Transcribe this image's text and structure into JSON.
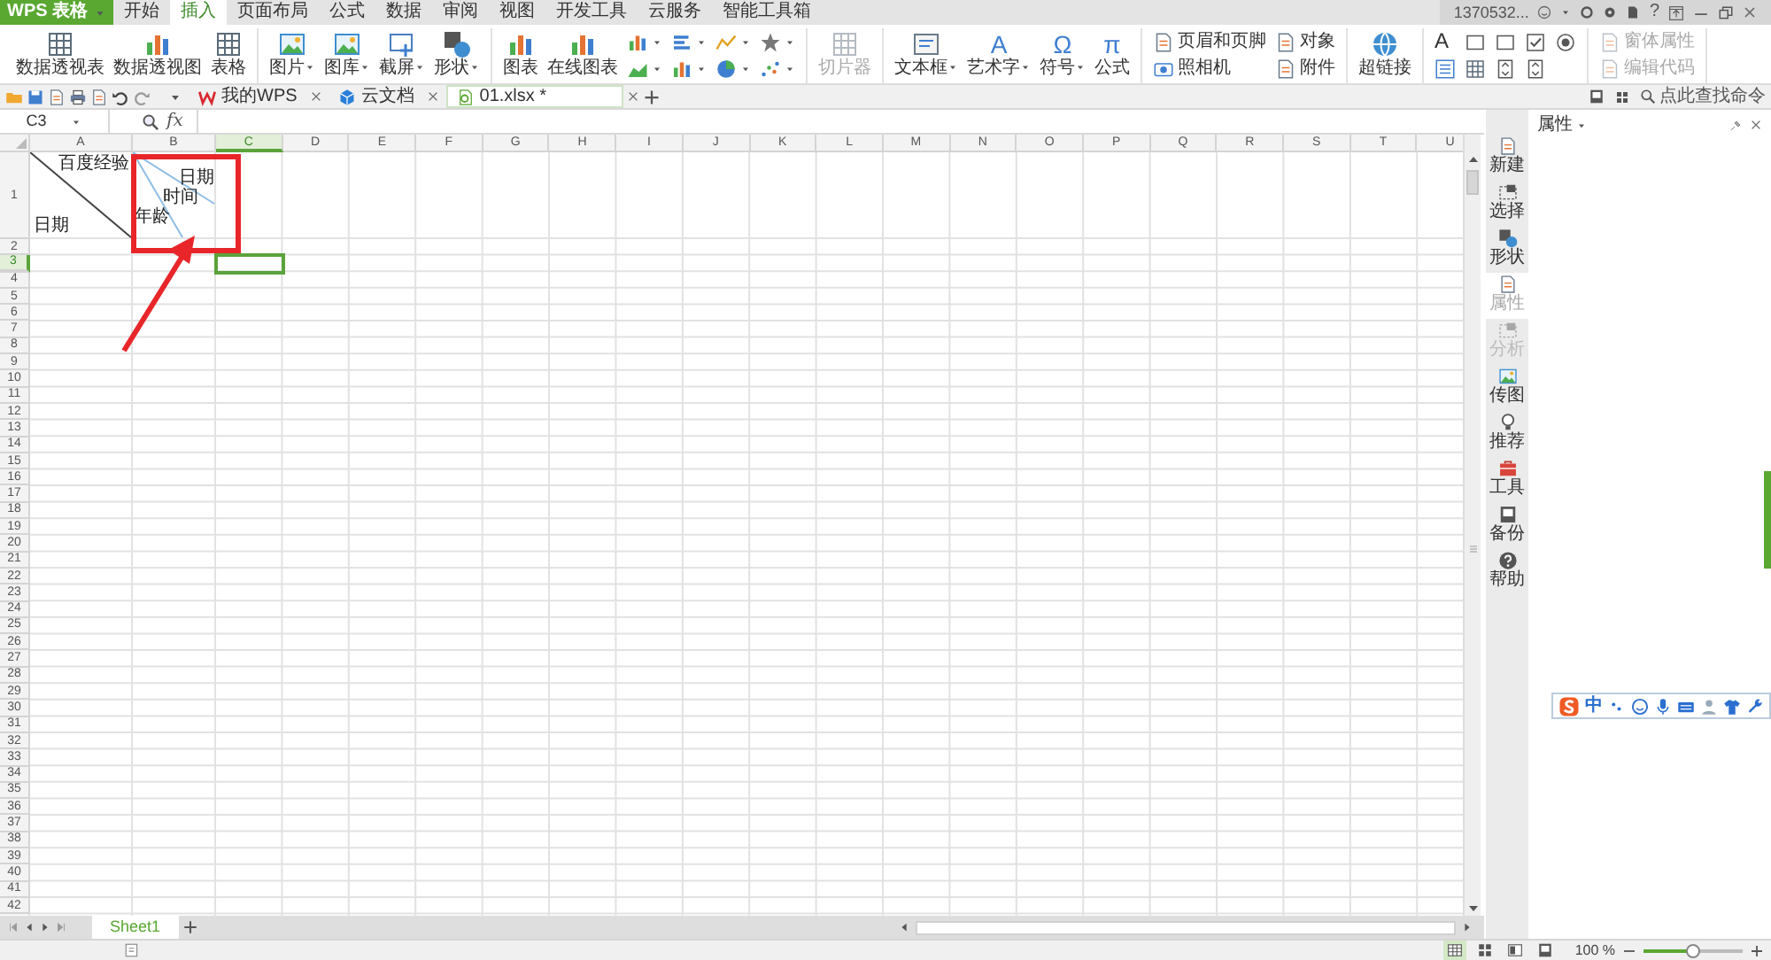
{
  "app_button": {
    "label": "WPS 表格"
  },
  "menu_tabs": [
    {
      "label": "开始",
      "selected": false
    },
    {
      "label": "插入",
      "selected": true
    },
    {
      "label": "页面布局",
      "selected": false
    },
    {
      "label": "公式",
      "selected": false
    },
    {
      "label": "数据",
      "selected": false
    },
    {
      "label": "审阅",
      "selected": false
    },
    {
      "label": "视图",
      "selected": false
    },
    {
      "label": "开发工具",
      "selected": false
    },
    {
      "label": "云服务",
      "selected": false
    },
    {
      "label": "智能工具箱",
      "selected": false
    }
  ],
  "account": {
    "user": "1370532...",
    "help": "?"
  },
  "ribbon_groups": [
    {
      "items": [
        {
          "kind": "large",
          "label": "数据透视表",
          "dropdown": false,
          "disabled": false
        },
        {
          "kind": "large",
          "label": "数据透视图",
          "dropdown": false,
          "disabled": false
        },
        {
          "kind": "large",
          "label": "表格",
          "dropdown": false,
          "disabled": false
        }
      ]
    },
    {
      "items": [
        {
          "kind": "large",
          "label": "图片",
          "dropdown": true,
          "disabled": false
        },
        {
          "kind": "large",
          "label": "图库",
          "dropdown": true,
          "disabled": false
        },
        {
          "kind": "large",
          "label": "截屏",
          "dropdown": true,
          "disabled": false
        },
        {
          "kind": "large",
          "label": "形状",
          "dropdown": true,
          "disabled": false
        }
      ]
    },
    {
      "items": [
        {
          "kind": "large",
          "label": "图表",
          "dropdown": false,
          "disabled": false
        },
        {
          "kind": "large",
          "label": "在线图表",
          "dropdown": false,
          "disabled": false
        },
        {
          "kind": "mini",
          "dropdown": true,
          "disabled": false
        },
        {
          "kind": "mini",
          "dropdown": true,
          "disabled": false
        },
        {
          "kind": "mini",
          "dropdown": true,
          "disabled": false
        },
        {
          "kind": "mini",
          "dropdown": true,
          "disabled": false
        },
        {
          "kind": "mini",
          "dropdown": true,
          "disabled": false
        },
        {
          "kind": "mini",
          "dropdown": true,
          "disabled": false
        },
        {
          "kind": "mini",
          "dropdown": true,
          "disabled": false
        },
        {
          "kind": "mini",
          "dropdown": true,
          "disabled": false
        }
      ]
    },
    {
      "items": [
        {
          "kind": "large",
          "label": "切片器",
          "dropdown": false,
          "disabled": true
        }
      ]
    },
    {
      "items": [
        {
          "kind": "large",
          "label": "文本框",
          "dropdown": true,
          "disabled": false
        },
        {
          "kind": "large",
          "label": "艺术字",
          "glyph": "A",
          "dropdown": true,
          "disabled": false
        },
        {
          "kind": "large",
          "label": "符号",
          "glyph": "Ω",
          "dropdown": true,
          "disabled": false
        },
        {
          "kind": "large",
          "label": "公式",
          "glyph": "π",
          "dropdown": false,
          "disabled": false
        }
      ]
    },
    {
      "items": [
        {
          "kind": "small",
          "label": "页眉和页脚",
          "dropdown": false,
          "disabled": false
        },
        {
          "kind": "small",
          "label": "照相机",
          "dropdown": false,
          "disabled": false
        },
        {
          "kind": "small",
          "label": "对象",
          "dropdown": false,
          "disabled": false
        },
        {
          "kind": "small",
          "label": "附件",
          "dropdown": false,
          "disabled": false
        }
      ]
    },
    {
      "items": [
        {
          "kind": "large",
          "label": "超链接",
          "dropdown": false,
          "disabled": false
        }
      ]
    },
    {
      "items": [
        {
          "kind": "mini",
          "glyph": "A",
          "dropdown": false,
          "disabled": false
        },
        {
          "kind": "mini",
          "dropdown": false,
          "disabled": false
        },
        {
          "kind": "mini",
          "dropdown": false,
          "disabled": false
        },
        {
          "kind": "mini",
          "dropdown": false,
          "disabled": false
        },
        {
          "kind": "mini",
          "dropdown": false,
          "disabled": false
        },
        {
          "kind": "mini",
          "dropdown": false,
          "disabled": false
        },
        {
          "kind": "mini",
          "dropdown": false,
          "disabled": false
        },
        {
          "kind": "mini",
          "dropdown": false,
          "disabled": false
        },
        {
          "kind": "mini",
          "dropdown": false,
          "disabled": false
        }
      ]
    },
    {
      "items": [
        {
          "kind": "small",
          "label": "窗体属性",
          "dropdown": false,
          "disabled": true
        },
        {
          "kind": "small",
          "label": "编辑代码",
          "dropdown": false,
          "disabled": true
        }
      ]
    }
  ],
  "doc_tabs": [
    {
      "label": "我的WPS",
      "selected": false
    },
    {
      "label": "云文档",
      "selected": false
    },
    {
      "label": "01.xlsx *",
      "selected": true
    }
  ],
  "command_search": {
    "label": "点此查找命令"
  },
  "formula_bar": {
    "name_box": "C3",
    "fx": "fx"
  },
  "sheet": {
    "columns": [
      {
        "label": "A",
        "selected": false
      },
      {
        "label": "B",
        "selected": false
      },
      {
        "label": "C",
        "selected": true
      },
      {
        "label": "D",
        "selected": false
      },
      {
        "label": "E",
        "selected": false
      },
      {
        "label": "F",
        "selected": false
      },
      {
        "label": "G",
        "selected": false
      },
      {
        "label": "H",
        "selected": false
      },
      {
        "label": "I",
        "selected": false
      },
      {
        "label": "J",
        "selected": false
      },
      {
        "label": "K",
        "selected": false
      },
      {
        "label": "L",
        "selected": false
      },
      {
        "label": "M",
        "selected": false
      },
      {
        "label": "N",
        "selected": false
      },
      {
        "label": "O",
        "selected": false
      },
      {
        "label": "P",
        "selected": false
      },
      {
        "label": "Q",
        "selected": false
      },
      {
        "label": "R",
        "selected": false
      },
      {
        "label": "S",
        "selected": false
      },
      {
        "label": "T",
        "selected": false
      },
      {
        "label": "U",
        "selected": false
      }
    ],
    "rows": [
      {
        "label": "1",
        "selected": false
      },
      {
        "label": "2",
        "selected": false
      },
      {
        "label": "3",
        "selected": true
      },
      {
        "label": "4",
        "selected": false
      },
      {
        "label": "5",
        "selected": false
      },
      {
        "label": "6",
        "selected": false
      },
      {
        "label": "7",
        "selected": false
      },
      {
        "label": "8",
        "selected": false
      },
      {
        "label": "9",
        "selected": false
      },
      {
        "label": "10",
        "selected": false
      },
      {
        "label": "11",
        "selected": false
      },
      {
        "label": "12",
        "selected": false
      },
      {
        "label": "13",
        "selected": false
      },
      {
        "label": "14",
        "selected": false
      },
      {
        "label": "15",
        "selected": false
      },
      {
        "label": "16",
        "selected": false
      },
      {
        "label": "17",
        "selected": false
      },
      {
        "label": "18",
        "selected": false
      },
      {
        "label": "19",
        "selected": false
      },
      {
        "label": "20",
        "selected": false
      },
      {
        "label": "21",
        "selected": false
      },
      {
        "label": "22",
        "selected": false
      },
      {
        "label": "23",
        "selected": false
      },
      {
        "label": "24",
        "selected": false
      },
      {
        "label": "25",
        "selected": false
      },
      {
        "label": "26",
        "selected": false
      },
      {
        "label": "27",
        "selected": false
      },
      {
        "label": "28",
        "selected": false
      },
      {
        "label": "29",
        "selected": false
      },
      {
        "label": "30",
        "selected": false
      },
      {
        "label": "31",
        "selected": false
      },
      {
        "label": "32",
        "selected": false
      },
      {
        "label": "33",
        "selected": false
      },
      {
        "label": "34",
        "selected": false
      },
      {
        "label": "35",
        "selected": false
      },
      {
        "label": "36",
        "selected": false
      },
      {
        "label": "37",
        "selected": false
      },
      {
        "label": "38",
        "selected": false
      },
      {
        "label": "39",
        "selected": false
      },
      {
        "label": "40",
        "selected": false
      },
      {
        "label": "41",
        "selected": false
      },
      {
        "label": "42",
        "selected": false
      }
    ],
    "diagonal_cells": [
      {
        "kind": "single",
        "texts": [
          "百度经验",
          "日期"
        ]
      },
      {
        "kind": "double",
        "texts": [
          "日期",
          "时间",
          "年龄"
        ]
      }
    ]
  },
  "sidebar": {
    "items": [
      {
        "label": "新建",
        "selected": false,
        "disabled": false
      },
      {
        "label": "选择",
        "selected": false,
        "disabled": false
      },
      {
        "label": "形状",
        "selected": false,
        "disabled": false
      },
      {
        "label": "属性",
        "selected": true,
        "disabled": false
      },
      {
        "label": "分析",
        "selected": false,
        "disabled": true
      },
      {
        "label": "传图",
        "selected": false,
        "disabled": false
      },
      {
        "label": "推荐",
        "selected": false,
        "disabled": false
      },
      {
        "label": "工具",
        "selected": false,
        "disabled": false
      },
      {
        "label": "备份",
        "selected": false,
        "disabled": false
      },
      {
        "label": "帮助",
        "selected": false,
        "disabled": false
      }
    ]
  },
  "panel": {
    "title": "属性"
  },
  "ime_toolbar": {
    "mode": "中"
  },
  "sheet_tabs": [
    {
      "label": "Sheet1",
      "selected": true
    }
  ],
  "status_bar": {
    "zoom": "100 %",
    "zoom_slider": {
      "level": 0.5
    }
  }
}
